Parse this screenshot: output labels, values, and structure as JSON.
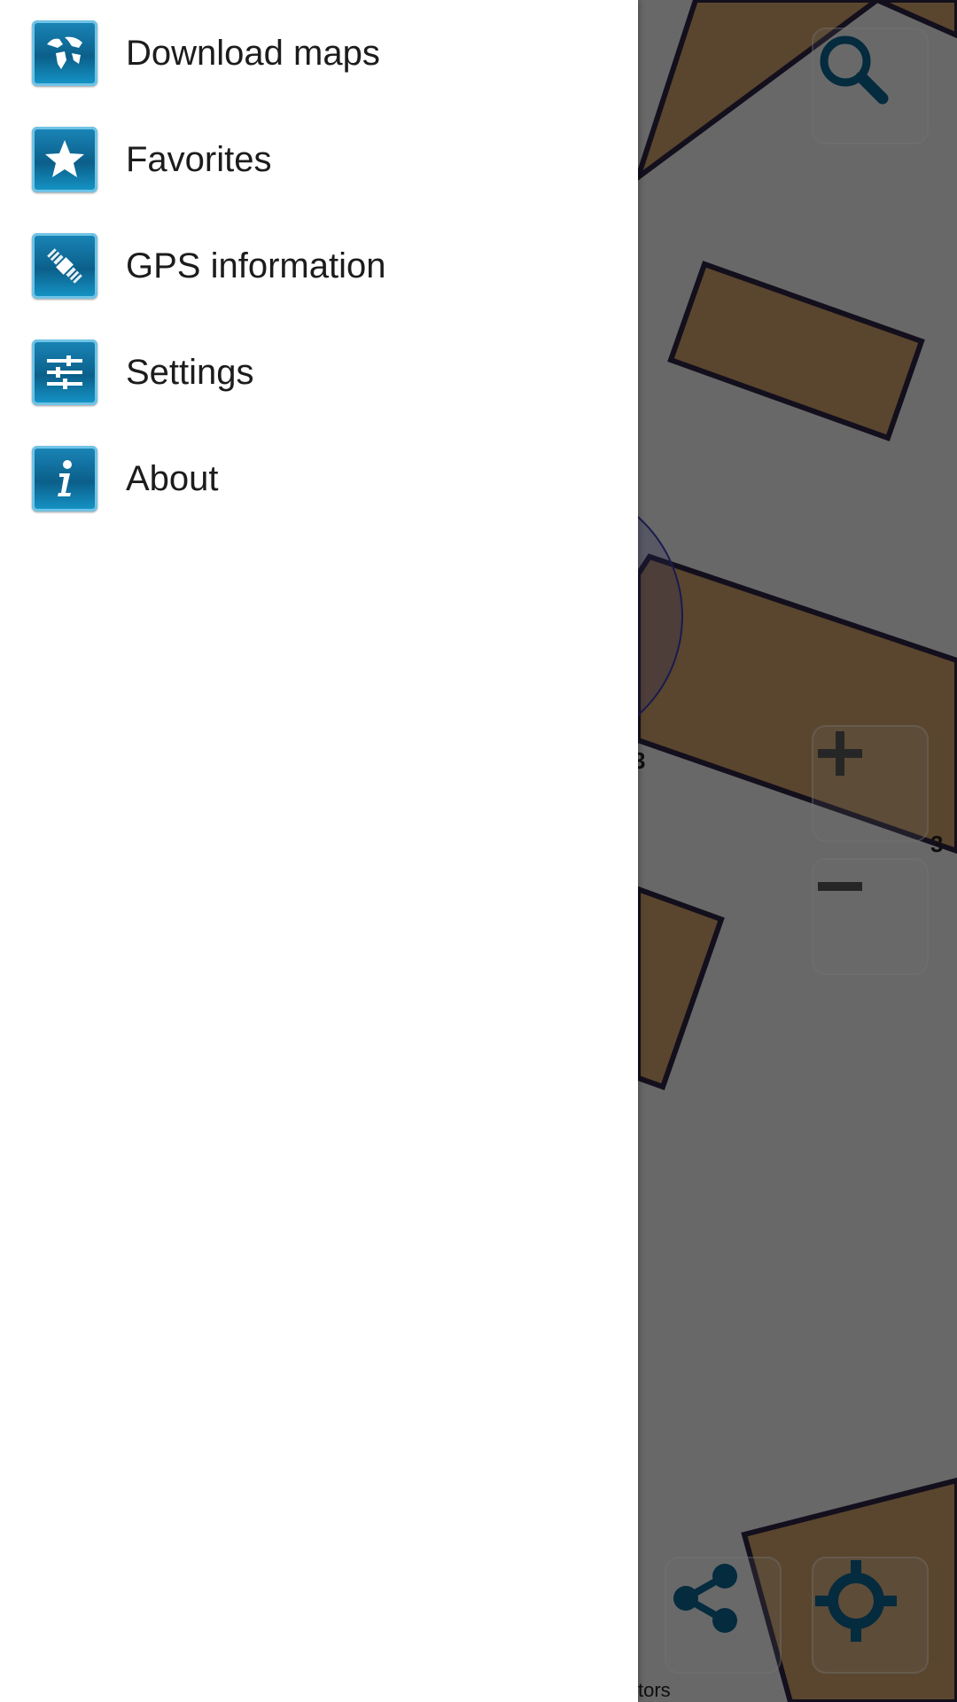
{
  "drawer": {
    "items": [
      {
        "label": "Download maps",
        "icon": "globe-map-icon"
      },
      {
        "label": "Favorites",
        "icon": "star-icon"
      },
      {
        "label": "GPS information",
        "icon": "satellite-icon"
      },
      {
        "label": "Settings",
        "icon": "sliders-icon"
      },
      {
        "label": "About",
        "icon": "info-icon"
      }
    ]
  },
  "map": {
    "house_numbers": [
      "3",
      "3"
    ],
    "attribution": "tors",
    "controls": {
      "search": "search-icon",
      "zoom_in": "plus-icon",
      "zoom_out": "minus-icon",
      "share": "share-icon",
      "locate": "crosshair-icon"
    }
  },
  "colors": {
    "building_fill": "#c79b67",
    "building_stroke": "#2a2340",
    "icon_blue": "#0b5f8a",
    "accuracy_circle": "#5a5acb"
  }
}
